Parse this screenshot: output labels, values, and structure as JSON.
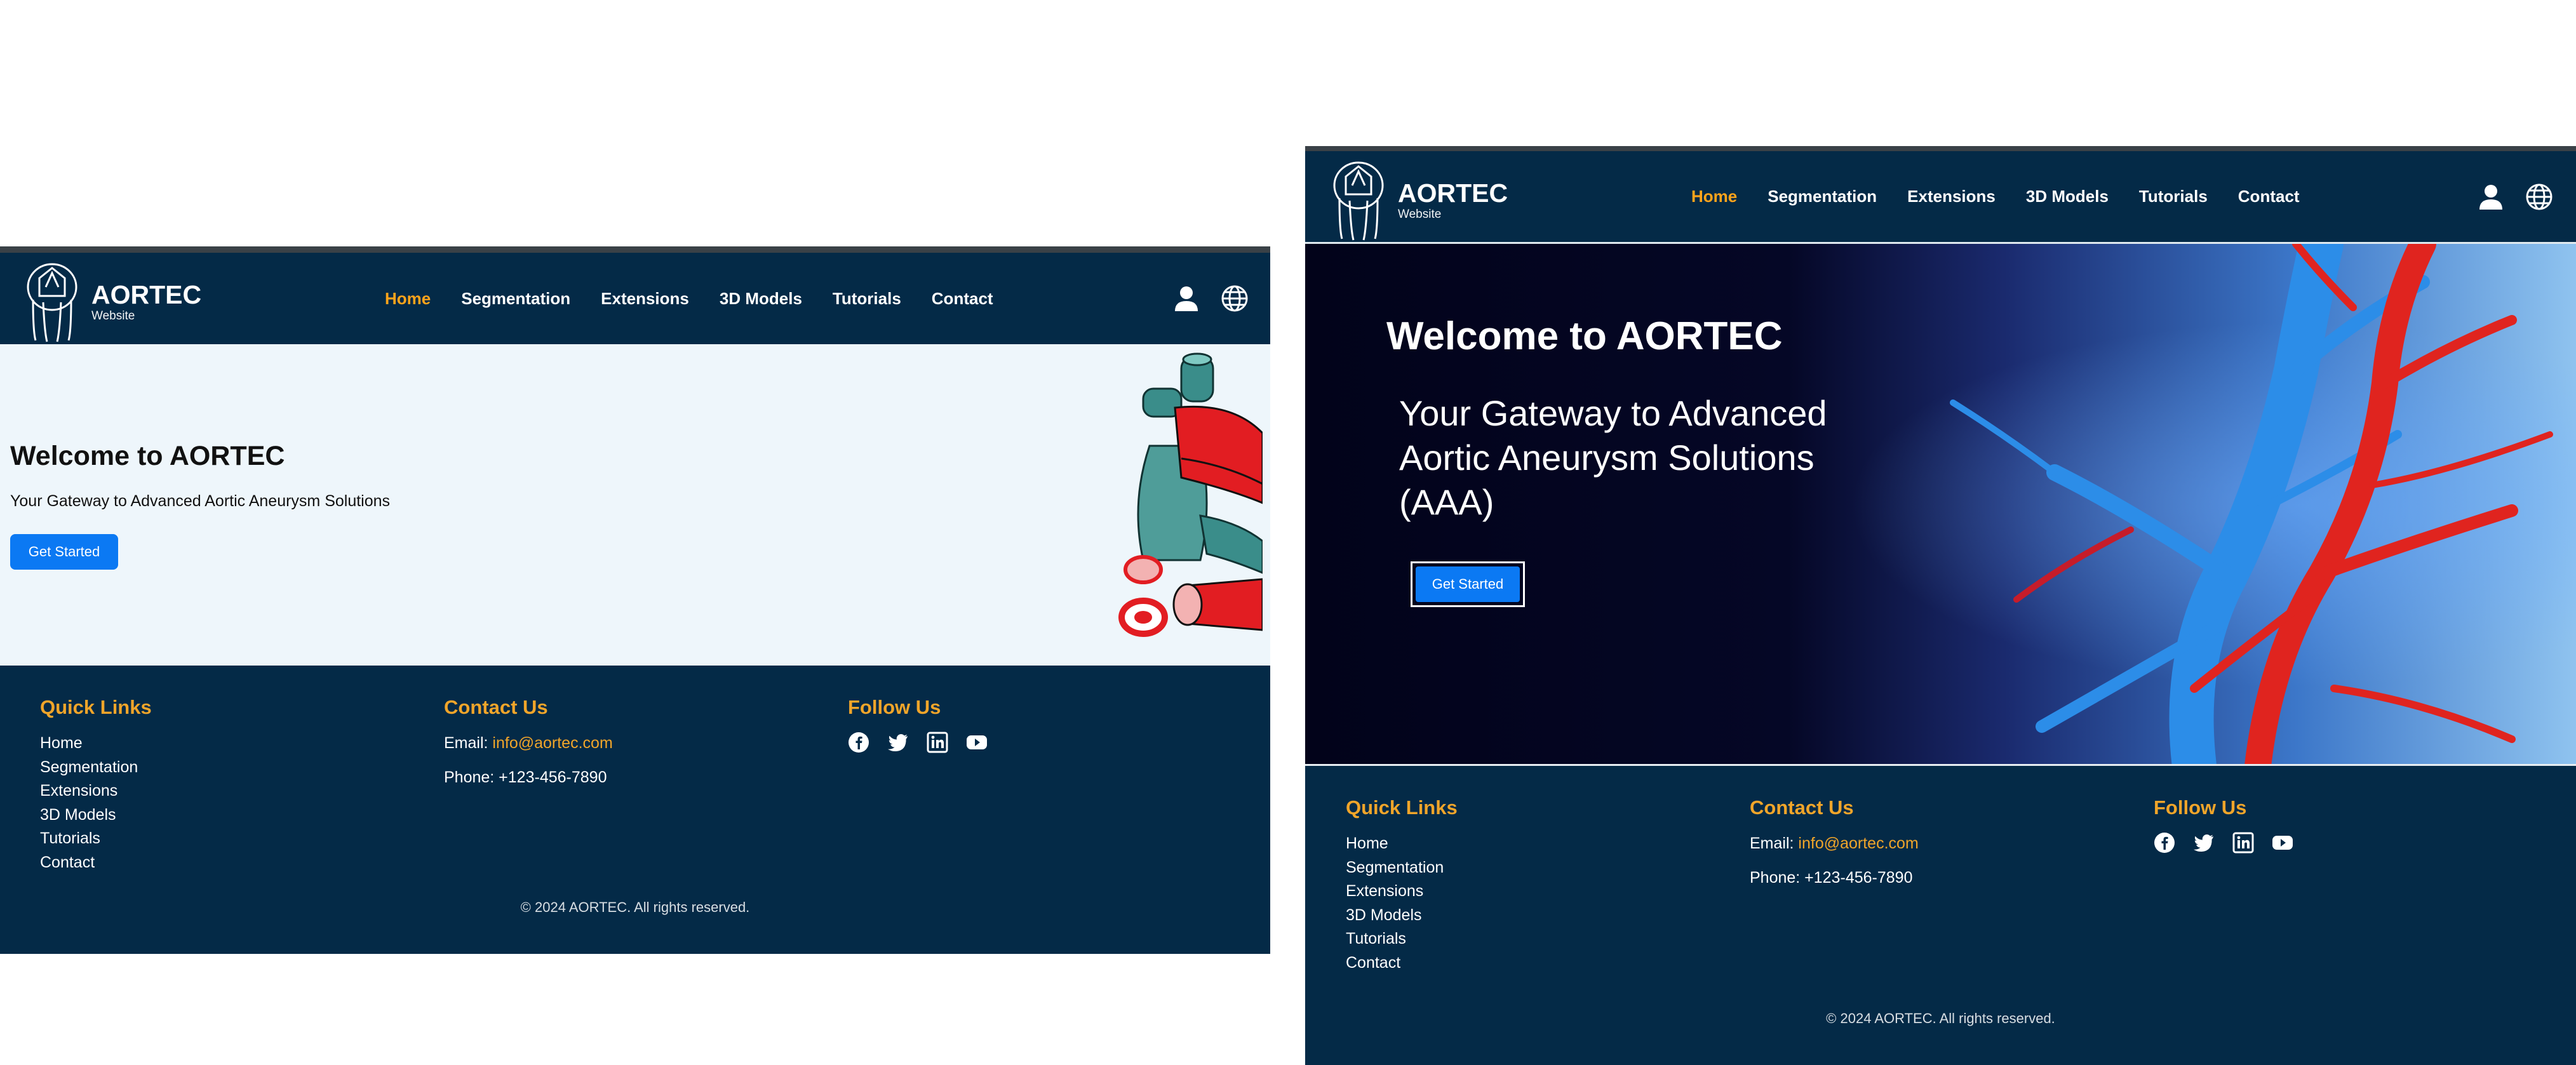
{
  "brand": {
    "name": "AORTEC",
    "tagline": "Website"
  },
  "nav": {
    "items": [
      "Home",
      "Segmentation",
      "Extensions",
      "3D Models",
      "Tutorials",
      "Contact"
    ],
    "active_index": 0
  },
  "header_icons": [
    "user-icon",
    "globe-icon"
  ],
  "hero_left": {
    "title": "Welcome to AORTEC",
    "subtitle": "Your Gateway to Advanced Aortic Aneurysm Solutions",
    "button": "Get Started"
  },
  "hero_right": {
    "title": "Welcome to AORTEC",
    "subtitle": "Your Gateway to Advanced Aortic Aneurysm Solutions (AAA)",
    "button": "Get Started"
  },
  "footer": {
    "quick_links": {
      "heading": "Quick Links",
      "items": [
        "Home",
        "Segmentation",
        "Extensions",
        "3D Models",
        "Tutorials",
        "Contact"
      ]
    },
    "contact": {
      "heading": "Contact Us",
      "email_label": "Email:",
      "email": "info@aortec.com",
      "phone": "Phone: +123-456-7890"
    },
    "follow": {
      "heading": "Follow Us",
      "icons": [
        "facebook-icon",
        "twitter-icon",
        "linkedin-icon",
        "youtube-icon"
      ]
    },
    "copyright": "© 2024 AORTEC. All rights reserved."
  },
  "colors": {
    "header_bg": "#042a47",
    "accent": "#ffa41b",
    "button": "#0b79f3",
    "hero_left_bg": "#eef6fb"
  }
}
